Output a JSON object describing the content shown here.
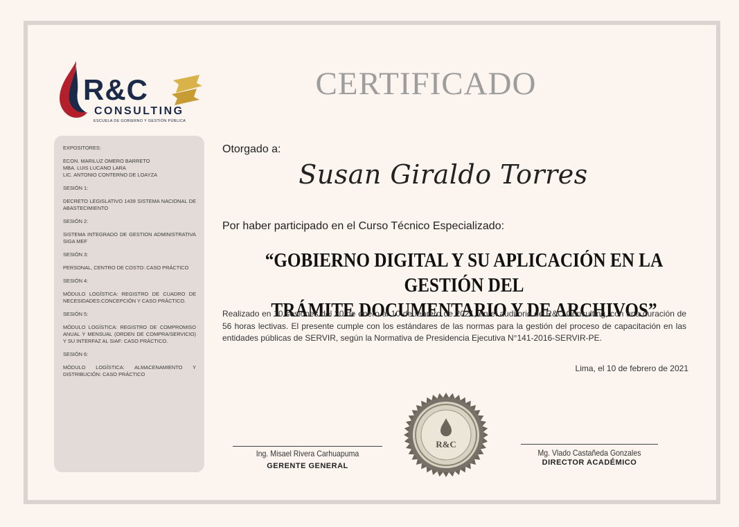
{
  "logo": {
    "brand": "R&C",
    "consulting": "CONSULTING",
    "subtitle": "ESCUELA DE GOBIERNO Y GESTIÓN PÚBLICA"
  },
  "certificate": {
    "title": "CERTIFICADO",
    "awarded_label": "Otorgado a:",
    "recipient": "Susan Giraldo Torres",
    "participation": "Por haber participado en el Curso Técnico Especializado:",
    "course_line1": "“GOBIERNO DIGITAL Y SU APLICACIÓN EN LA GESTIÓN DEL",
    "course_line2": "TRÁMITE DOCUMENTARIO Y DE ARCHIVOS”",
    "body": "Realizado en 10 sesiones del 20 de enero al 10 de febrero de 2021,  en el auditorio de R&C Consulting, con una duración de 56 horas lectivas. El presente cumple con los estándares de las normas para la gestión del proceso de capacitación en las entidades públicas de SERVIR, según la Normativa de Presidencia Ejecutiva N°141-2016-SERVIR-PE.",
    "date": "Lima, el 10 de febrero de 2021"
  },
  "panel": {
    "speakers_head": "EXPOSITORES:",
    "speakers": [
      "ECON. MARILUZ OMERO BARRETO",
      "MBA. LUIS LUCANO LARA",
      "LIC. ANTONIO CONTERNO DE LOAYZA"
    ],
    "sessions": [
      {
        "head": "SESIÓN 1:",
        "text": "DECRETO LEGISLATIVO 1439 SISTEMA NACIONAL DE ABASTECIMIENTO"
      },
      {
        "head": "SESIÓN 2:",
        "text": "SISTEMA INTEGRADO DE GESTION ADMINISTRATIVA SIGA MEF"
      },
      {
        "head": "SESIÓN 3:",
        "text": "PERSONAL, CENTRO DE COSTO: CASO PRÁCTICO"
      },
      {
        "head": "SESIÓN 4:",
        "text": "MÓDULO LOGÍSTICA: REGISTRO DE CUADRO DE NECESIDADES:CONCEPCIÓN Y CASO PRÁCTICO."
      },
      {
        "head": "SESIÓN 5:",
        "text": "MÓDULO LOGÍSTICA: REGISTRO DE COMPROMISO ANUAL Y MENSUAL (ORDEN DE COMPRA/SERVICIO) Y SU INTERFAZ AL SIAF: CASO PRÁCTICO."
      },
      {
        "head": "SESIÓN 6:",
        "text": "MÓDULO LOGÍSTICA: ALMACENAMIENTO Y DISTRIBUCIÓN: CASO PRÁCTICO"
      }
    ]
  },
  "signatures": {
    "left_name": "Ing. Misael Rivera Carhuapuma",
    "left_role": "GERENTE GENERAL",
    "right_name": "Mg. Vlado Castañeda Gonzales",
    "right_role": "DIRECTOR ACADÉMICO"
  },
  "seal": {
    "text": "R&C"
  },
  "colors": {
    "background": "#fbf4ef",
    "frame": "#dad3cf",
    "panel": "#e3dbd7",
    "title": "#9d9d9d",
    "brand_navy": "#1b2a48",
    "brand_red": "#b3202c",
    "ribbon_gold": "#d9b24a"
  }
}
